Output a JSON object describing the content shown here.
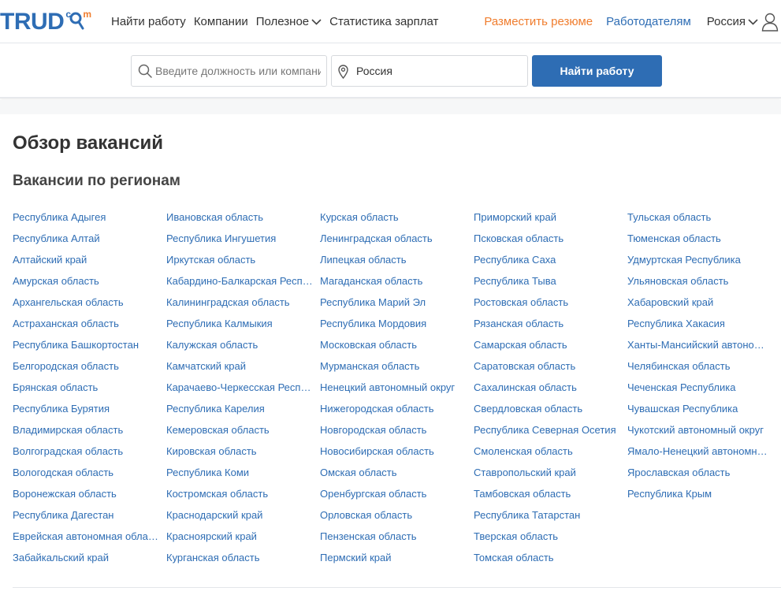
{
  "logo": {
    "word": "TRUD",
    "sup_left": "c",
    "sup_right": "m"
  },
  "nav": {
    "items": [
      {
        "label": "Найти работу"
      },
      {
        "label": "Компании"
      },
      {
        "label": "Полезное"
      },
      {
        "label": "Статистика зарплат"
      }
    ],
    "post_resume": "Разместить резюме",
    "employers": "Работодателям",
    "region": "Россия"
  },
  "search": {
    "placeholder": "Введите должность или компанию",
    "location_value": "Россия",
    "button_label": "Найти работу"
  },
  "main": {
    "title": "Обзор вакансий",
    "section_title": "Вакансии по регионам"
  },
  "regions": {
    "columns": [
      [
        "Республика Адыгея",
        "Республика Алтай",
        "Алтайский край",
        "Амурская область",
        "Архангельская область",
        "Астраханская область",
        "Республика Башкортостан",
        "Белгородская область",
        "Брянская область",
        "Республика Бурятия",
        "Владимирская область",
        "Волгоградская область",
        "Вологодская область",
        "Воронежская область",
        "Республика Дагестан",
        "Еврейская автономная обласЕврейская автономная область",
        "Забайкальский край"
      ],
      [
        "Ивановская область",
        "Республика Ингушетия",
        "Иркутская область",
        "Кабардино-Балкарская Республика",
        "Калининградская область",
        "Республика Калмыкия",
        "Калужская область",
        "Камчатский край",
        "Карачаево-Черкесская Республика",
        "Республика Карелия",
        "Кемеровская область",
        "Кировская область",
        "Республика Коми",
        "Костромская область",
        "Краснодарский край",
        "Красноярский край",
        "Курганская область"
      ],
      [
        "Курская область",
        "Ленинградская область",
        "Липецкая область",
        "Магаданская область",
        "Республика Марий Эл",
        "Республика Мордовия",
        "Московская область",
        "Мурманская область",
        "Ненецкий автономный округ",
        "Нижегородская область",
        "Новгородская область",
        "Новосибирская область",
        "Омская область",
        "Оренбургская область",
        "Орловская область",
        "Пензенская область",
        "Пермский край"
      ],
      [
        "Приморский край",
        "Псковская область",
        "Республика Саха",
        "Республика Тыва",
        "Ростовская область",
        "Рязанская область",
        "Самарская область",
        "Саратовская область",
        "Сахалинская область",
        "Свердловская область",
        "Республика Северная Осетия",
        "Смоленская область",
        "Ставропольский край",
        "Тамбовская область",
        "Республика Татарстан",
        "Тверская область",
        "Томская область"
      ],
      [
        "Тульская область",
        "Тюменская область",
        "Удмуртская Республика",
        "Ульяновская область",
        "Хабаровский край",
        "Республика Хакасия",
        "Ханты-Мансийский автономный округ",
        "Челябинская область",
        "Чеченская Республика",
        "Чувашская Республика",
        "Чукотский автономный округ",
        "Ямало-Ненецкий автономный округ",
        "Ярославская область",
        "Республика Крым"
      ]
    ]
  },
  "colors": {
    "brand": "#2e6db4",
    "accent": "#f07d2e"
  },
  "icons": {
    "search": "search-icon",
    "location": "location-pin-icon",
    "user": "user-icon",
    "chevron": "chevron-down-icon"
  }
}
